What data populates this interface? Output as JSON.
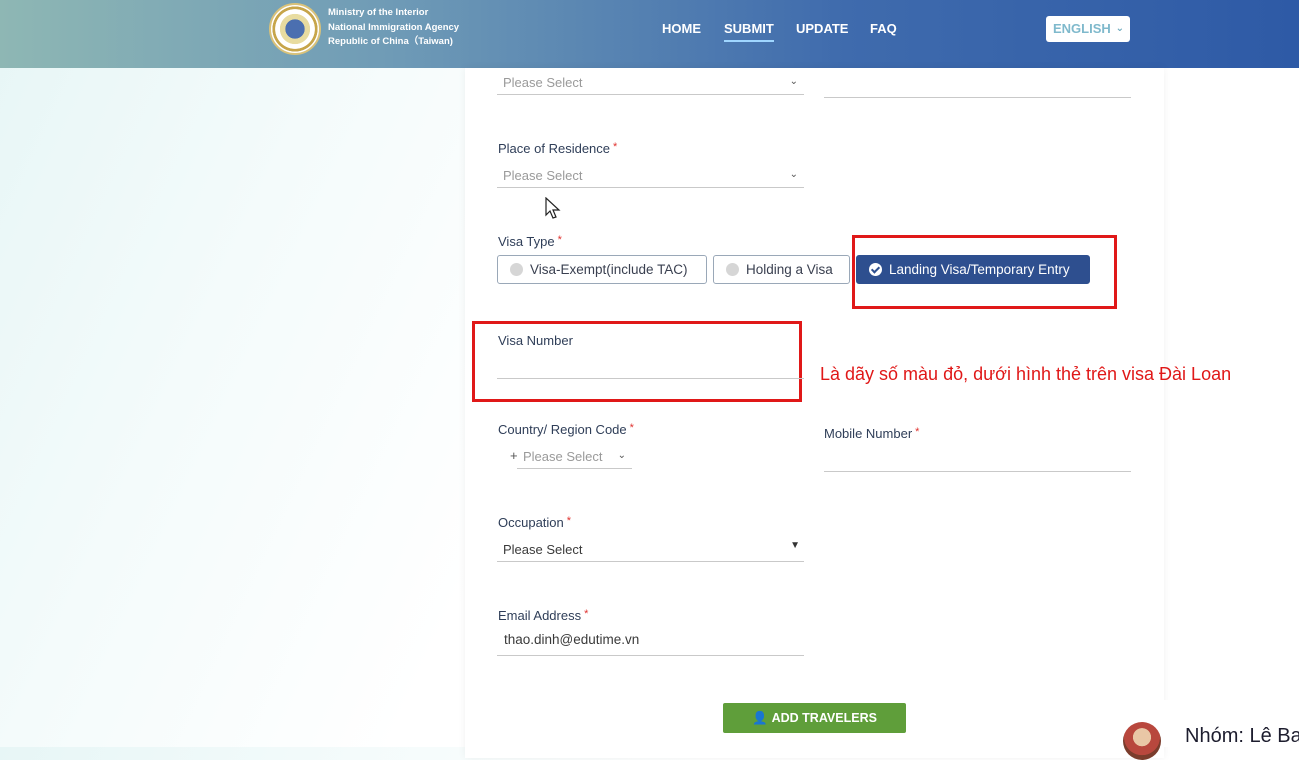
{
  "header": {
    "agency_lines": [
      "Ministry of the Interior",
      "National Immigration Agency",
      "Republic of China（Taiwan)"
    ],
    "nav": [
      "HOME",
      "SUBMIT",
      "UPDATE",
      "FAQ"
    ],
    "active_nav": "SUBMIT",
    "language": "ENGLISH"
  },
  "form": {
    "top_select_placeholder": "Please Select",
    "residence_label": "Place of Residence",
    "residence_placeholder": "Please Select",
    "visa_type_label": "Visa Type",
    "visa_options": [
      "Visa-Exempt(include TAC)",
      "Holding a Visa",
      "Landing Visa/Temporary Entry"
    ],
    "visa_selected": "Landing Visa/Temporary Entry",
    "visa_number_label": "Visa Number",
    "visa_number_value": "",
    "country_code_label": "Country/ Region Code",
    "country_code_prefix": "+",
    "country_code_placeholder": "Please Select",
    "mobile_label": "Mobile Number",
    "mobile_value": "",
    "occupation_label": "Occupation",
    "occupation_value": "Please Select",
    "email_label": "Email Address",
    "email_value": "thao.dinh@edutime.vn",
    "required_mark": "*",
    "add_travelers_label": "ADD TRAVELERS"
  },
  "annotation": {
    "note": "Là dãy số màu đỏ, dưới hình thẻ trên visa Đài Loan",
    "highlight_color": "#e01818"
  },
  "overlay": {
    "group_text": "Nhóm: Lê Ba"
  },
  "colors": {
    "selected_radio": "#2e4f8f",
    "add_button": "#5f9e3a",
    "required": "#e0322f"
  }
}
